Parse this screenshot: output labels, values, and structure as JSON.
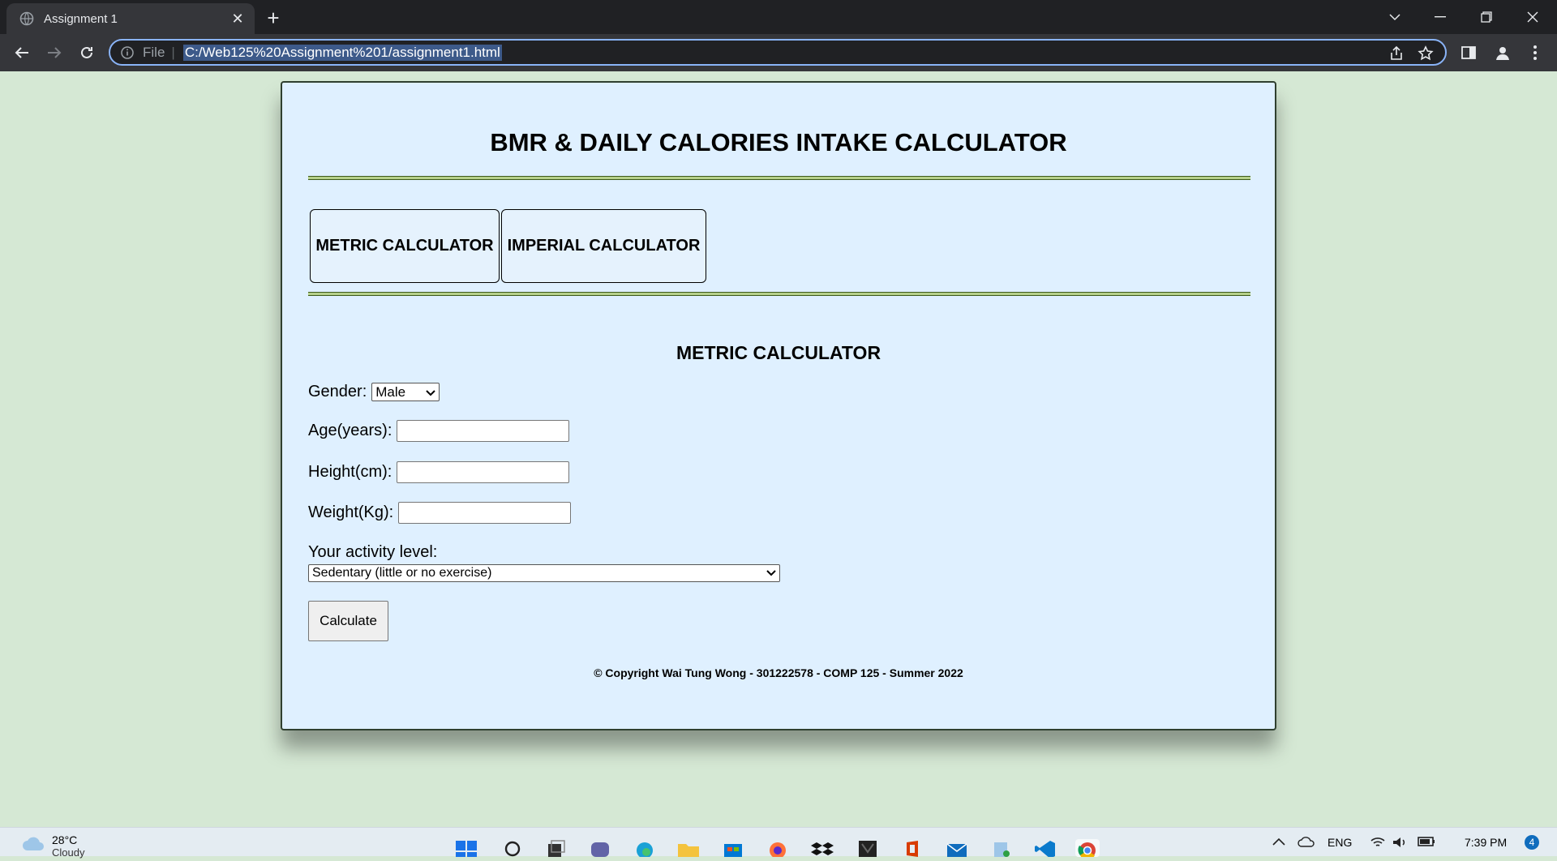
{
  "browser": {
    "tab_title": "Assignment 1",
    "omnibox": {
      "scheme_label": "File",
      "separator": "|",
      "url": "C:/Web125%20Assignment%201/assignment1.html"
    }
  },
  "page": {
    "title": "BMR & DAILY CALORIES INTAKE CALCULATOR",
    "tabs": [
      {
        "label": "METRIC CALCULATOR"
      },
      {
        "label": "IMPERIAL CALCULATOR"
      }
    ],
    "section_title": "METRIC CALCULATOR",
    "form": {
      "gender_label": "Gender:",
      "gender_value": "Male",
      "age_label": "Age(years):",
      "height_label": "Height(cm):",
      "weight_label": "Weight(Kg):",
      "activity_label": "Your activity level:",
      "activity_value": "Sedentary (little or no exercise)",
      "calculate_label": "Calculate"
    },
    "copyright": "© Copyright Wai Tung Wong - 301222578 - COMP 125 - Summer 2022"
  },
  "taskbar": {
    "weather_temp": "28°C",
    "weather_cond": "Cloudy",
    "language": "ENG",
    "clock_time": "7:39 PM",
    "notification_count": "4"
  },
  "colors": {
    "page_bg": "#d5e8d4",
    "card_bg": "#dff0ff",
    "rule_color": "#b5d08a",
    "chrome_dark": "#202124",
    "chrome_mid": "#35363a",
    "focus_blue": "#8ab4f8"
  }
}
